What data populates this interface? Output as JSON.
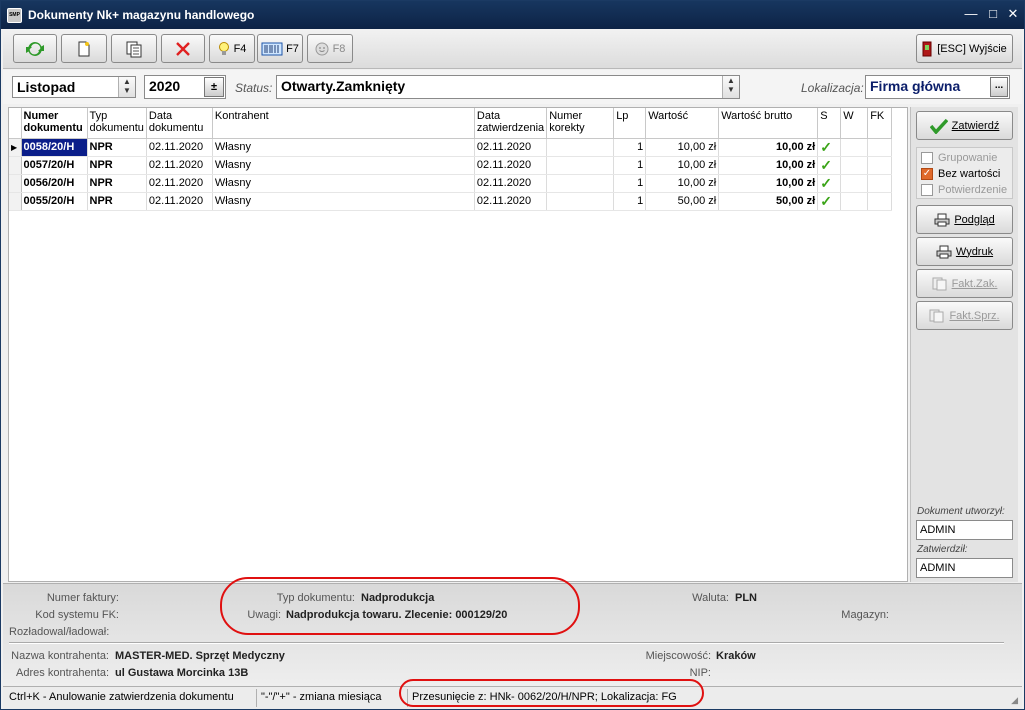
{
  "window": {
    "title": "Dokumenty Nk+ magazynu handlowego",
    "app_icon_text": "SMP"
  },
  "toolbar": {
    "f4": "F4",
    "f7": "F7",
    "f8": "F8",
    "exit": "[ESC] Wyjście"
  },
  "filter": {
    "month": "Listopad",
    "year": "2020",
    "status_label": "Status:",
    "status_value": "Otwarty.Zamknięty",
    "location_label": "Lokalizacja:",
    "location_value": "Firma główna",
    "location_btn": "..."
  },
  "table": {
    "headers": [
      "Numer dokumentu",
      "Typ dokumentu",
      "Data dokumentu",
      "Kontrahent",
      "Data zatwierdzenia",
      "Numer korekty",
      "Lp",
      "Wartość",
      "Wartość brutto",
      "S",
      "W",
      "FK"
    ],
    "rows": [
      {
        "numer": "0058/20/H",
        "typ": "NPR",
        "data": "02.11.2020",
        "kontrahent": "Własny",
        "data_zatw": "02.11.2020",
        "korekta": "",
        "lp": "1",
        "wartosc": "10,00 zł",
        "brutto": "10,00 zł",
        "s": "✓",
        "w": "",
        "fk": ""
      },
      {
        "numer": "0057/20/H",
        "typ": "NPR",
        "data": "02.11.2020",
        "kontrahent": "Własny",
        "data_zatw": "02.11.2020",
        "korekta": "",
        "lp": "1",
        "wartosc": "10,00 zł",
        "brutto": "10,00 zł",
        "s": "✓",
        "w": "",
        "fk": ""
      },
      {
        "numer": "0056/20/H",
        "typ": "NPR",
        "data": "02.11.2020",
        "kontrahent": "Własny",
        "data_zatw": "02.11.2020",
        "korekta": "",
        "lp": "1",
        "wartosc": "10,00 zł",
        "brutto": "10,00 zł",
        "s": "✓",
        "w": "",
        "fk": ""
      },
      {
        "numer": "0055/20/H",
        "typ": "NPR",
        "data": "02.11.2020",
        "kontrahent": "Własny",
        "data_zatw": "02.11.2020",
        "korekta": "",
        "lp": "1",
        "wartosc": "50,00 zł",
        "brutto": "50,00 zł",
        "s": "✓",
        "w": "",
        "fk": ""
      }
    ]
  },
  "side": {
    "confirm": "Zatwierdź",
    "grupowanie": "Grupowanie",
    "bez_wartosci": "Bez wartości",
    "potwierdzenie": "Potwierdzenie",
    "podglad": "Podgląd",
    "wydruk": "Wydruk",
    "fakt_zak": "Fakt.Zak.",
    "fakt_sprz": "Fakt.Sprz.",
    "created_label": "Dokument utworzył:",
    "created_value": "ADMIN",
    "approved_label": "Zatwierdził:",
    "approved_value": "ADMIN"
  },
  "info": {
    "numer_faktury_label": "Numer faktury:",
    "kod_fk_label": "Kod systemu FK:",
    "rozladowal_label": "Rozładowal/ładował:",
    "typ_label": "Typ dokumentu:",
    "typ_value": "Nadprodukcja",
    "uwagi_label": "Uwagi:",
    "uwagi_value": "Nadprodukcja towaru. Zlecenie: 000129/20",
    "waluta_label": "Waluta:",
    "waluta_value": "PLN",
    "magazyn_label": "Magazyn:",
    "nazwa_label": "Nazwa kontrahenta:",
    "nazwa_value": "MASTER-MED. Sprzęt Medyczny",
    "adres_label": "Adres kontrahenta:",
    "adres_value": "ul Gustawa Morcinka 13B",
    "miejscowosc_label": "Miejscowość:",
    "miejscowosc_value": "Kraków",
    "nip_label": "NIP:"
  },
  "status": {
    "s1": "Ctrl+K - Anulowanie zatwierdzenia dokumentu",
    "s2": "\"-\"/\"+\" - zmiana miesiąca",
    "s3": "Przesunięcie z: HNk- 0062/20/H/NPR; Lokalizacja: FG"
  }
}
